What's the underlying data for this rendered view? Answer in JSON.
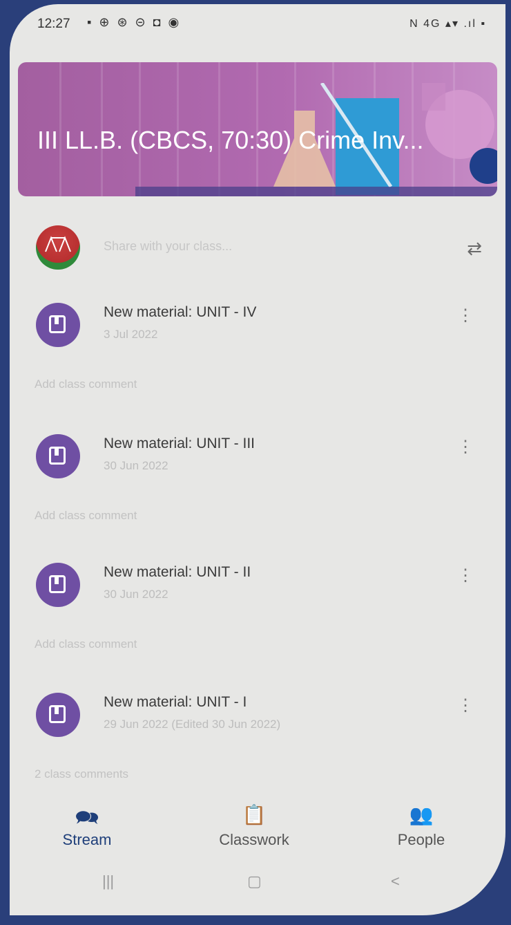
{
  "status": {
    "time": "12:27",
    "left_icons": "▪ ⊕ ⊛ ⊝ ◘ ◉",
    "right_icons": "N 4G ▴▾ .ıl ▪"
  },
  "banner": {
    "title": "III LL.B. (CBCS, 70:30) Crime Inv...",
    "color": "#a35fa0"
  },
  "share": {
    "placeholder": "Share with your class..."
  },
  "posts": [
    {
      "title": "New material: UNIT - IV",
      "date": "3 Jul 2022",
      "comment": "Add class comment"
    },
    {
      "title": "New material: UNIT - III",
      "date": "30 Jun 2022",
      "comment": "Add class comment"
    },
    {
      "title": "New material: UNIT - II",
      "date": "30 Jun 2022",
      "comment": "Add class comment"
    },
    {
      "title": "New material: UNIT - I",
      "date": "29 Jun 2022 (Edited 30 Jun 2022)",
      "comment": "2 class comments"
    }
  ],
  "nav": {
    "stream": "Stream",
    "classwork": "Classwork",
    "people": "People",
    "active_color": "#1f3f7a"
  },
  "system_nav": {
    "recents": "|||",
    "home": "▢",
    "back": "<"
  }
}
